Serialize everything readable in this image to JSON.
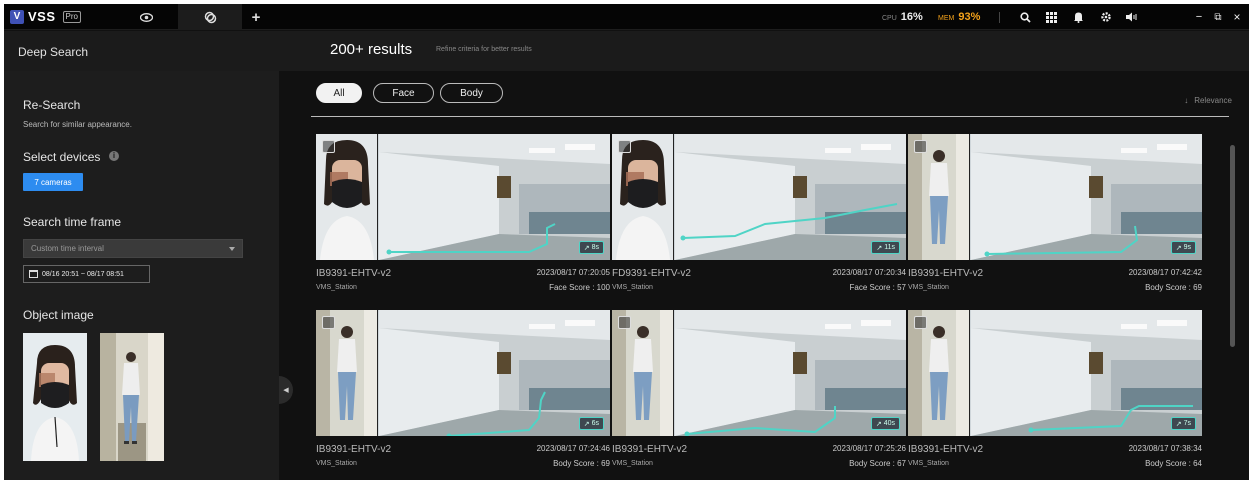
{
  "topbar": {
    "logo_text": "VSS",
    "logo_badge": "Pro",
    "add_tab_symbol": "+",
    "cpu_label": "CPU",
    "cpu_value": "16%",
    "mem_label": "MEM",
    "mem_value": "93%",
    "window_min": "−",
    "window_restore": "⧉",
    "window_close": "×"
  },
  "header": {
    "page_title": "Deep Search",
    "results_count": "200+ results",
    "results_hint": "Refine criteria for better results"
  },
  "left": {
    "research_title": "Re-Search",
    "research_sub": "Search for similar appearance.",
    "devices_title": "Select devices",
    "devices_button": "7 cameras",
    "timeframe_title": "Search time frame",
    "timeframe_select": "Custom time interval",
    "timeframe_range": "08/16 20:51 ~ 08/17 08:51",
    "object_title": "Object image"
  },
  "filters": {
    "chips": [
      "All",
      "Face",
      "Body"
    ],
    "active": "All",
    "sort_label": "Relevance"
  },
  "colors": {
    "accent": "#2d8cf0",
    "mem_warning": "#f4a21b",
    "trail": "#4fd4c6",
    "brand": "#3f51b5"
  },
  "results": [
    {
      "camera": "IB9391-EHTV-v2",
      "station": "VMS_Station",
      "time": "2023/08/17 07:20:05",
      "score": "Face Score : 100",
      "duration": "8s"
    },
    {
      "camera": "FD9391-EHTV-v2",
      "station": "VMS_Station",
      "time": "2023/08/17 07:20:34",
      "score": "Face Score : 57",
      "duration": "11s"
    },
    {
      "camera": "IB9391-EHTV-v2",
      "station": "VMS_Station",
      "time": "2023/08/17 07:42:42",
      "score": "Body Score : 69",
      "duration": "9s"
    },
    {
      "camera": "IB9391-EHTV-v2",
      "station": "VMS_Station",
      "time": "2023/08/17 07:24:46",
      "score": "Body Score : 69",
      "duration": "6s"
    },
    {
      "camera": "IB9391-EHTV-v2",
      "station": "VMS_Station",
      "time": "2023/08/17 07:25:26",
      "score": "Body Score : 67",
      "duration": "40s"
    },
    {
      "camera": "IB9391-EHTV-v2",
      "station": "VMS_Station",
      "time": "2023/08/17 07:38:34",
      "score": "Body Score : 64",
      "duration": "7s"
    }
  ]
}
